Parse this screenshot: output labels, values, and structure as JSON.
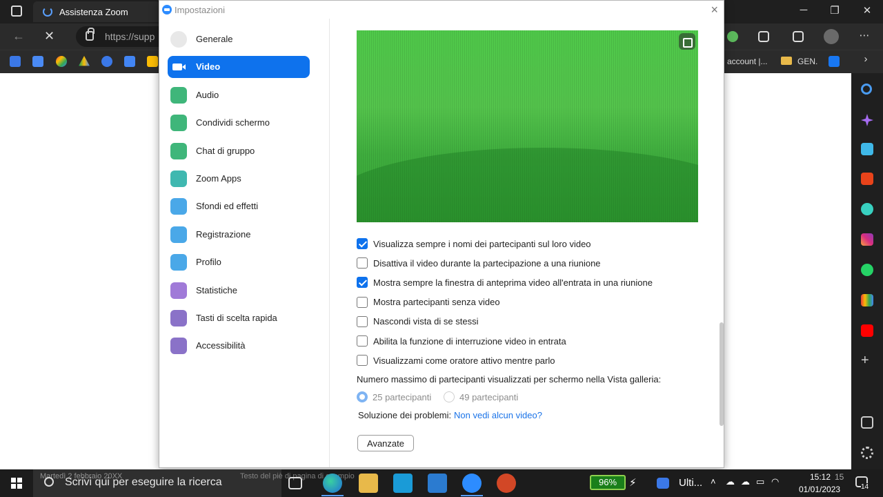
{
  "browser": {
    "tab_title": "Assistenza Zoom",
    "url": "https://supp",
    "bookmarks": {
      "account": "account |...",
      "gen": "GEN."
    }
  },
  "window": {
    "title": "Impostazioni",
    "close_glyph": "×"
  },
  "sidebar": {
    "items": [
      {
        "label": "Generale",
        "icon": "gear-icon",
        "color": "#e8e8e8"
      },
      {
        "label": "Video",
        "icon": "video-camera-icon",
        "color": "#0e72ed",
        "active": true
      },
      {
        "label": "Audio",
        "icon": "headphones-icon",
        "color": "#3fb67a"
      },
      {
        "label": "Condividi schermo",
        "icon": "share-screen-icon",
        "color": "#3fb67a"
      },
      {
        "label": "Chat di gruppo",
        "icon": "chat-icon",
        "color": "#3fb67a"
      },
      {
        "label": "Zoom Apps",
        "icon": "apps-icon",
        "color": "#3fb8b0"
      },
      {
        "label": "Sfondi ed effetti",
        "icon": "background-icon",
        "color": "#4aa8e8"
      },
      {
        "label": "Registrazione",
        "icon": "record-icon",
        "color": "#4aa8e8"
      },
      {
        "label": "Profilo",
        "icon": "profile-icon",
        "color": "#4aa8e8"
      },
      {
        "label": "Statistiche",
        "icon": "stats-icon",
        "color": "#a07ad8"
      },
      {
        "label": "Tasti di scelta rapida",
        "icon": "keyboard-icon",
        "color": "#8a72c8"
      },
      {
        "label": "Accessibilità",
        "icon": "accessibility-icon",
        "color": "#8a72c8"
      }
    ]
  },
  "video": {
    "options": [
      {
        "label": "Visualizza sempre i nomi dei partecipanti sul loro video",
        "checked": true
      },
      {
        "label": "Disattiva il video durante la partecipazione a una riunione",
        "checked": false
      },
      {
        "label": "Mostra sempre la finestra di anteprima video all'entrata in una riunione",
        "checked": true
      },
      {
        "label": "Mostra partecipanti senza video",
        "checked": false
      },
      {
        "label": "Nascondi vista di se stessi",
        "checked": false
      },
      {
        "label": "Abilita la funzione di interruzione video in entrata",
        "checked": false
      },
      {
        "label": "Visualizzami come oratore attivo mentre parlo",
        "checked": false
      }
    ],
    "gallery_label": "Numero massimo di partecipanti visualizzati per schermo nella Vista galleria:",
    "gallery_options": [
      {
        "label": "25 partecipanti",
        "selected": true
      },
      {
        "label": "49 partecipanti",
        "selected": false
      }
    ],
    "troubleshoot_label": "Soluzione dei problemi:",
    "troubleshoot_link": "Non vedi alcun video?",
    "advanced_button": "Avanzate"
  },
  "taskbar": {
    "search_placeholder": "Scrivi qui per eseguire la ricerca",
    "search_date_hint": "Martedì 2 febbraio 20XX",
    "doc_hint": "Testo del piè di pagina di esempio",
    "battery": "96%",
    "weather": "Ulti...",
    "time": "15:12",
    "date": "01/01/2023",
    "notifications": "14",
    "extra": "15"
  }
}
